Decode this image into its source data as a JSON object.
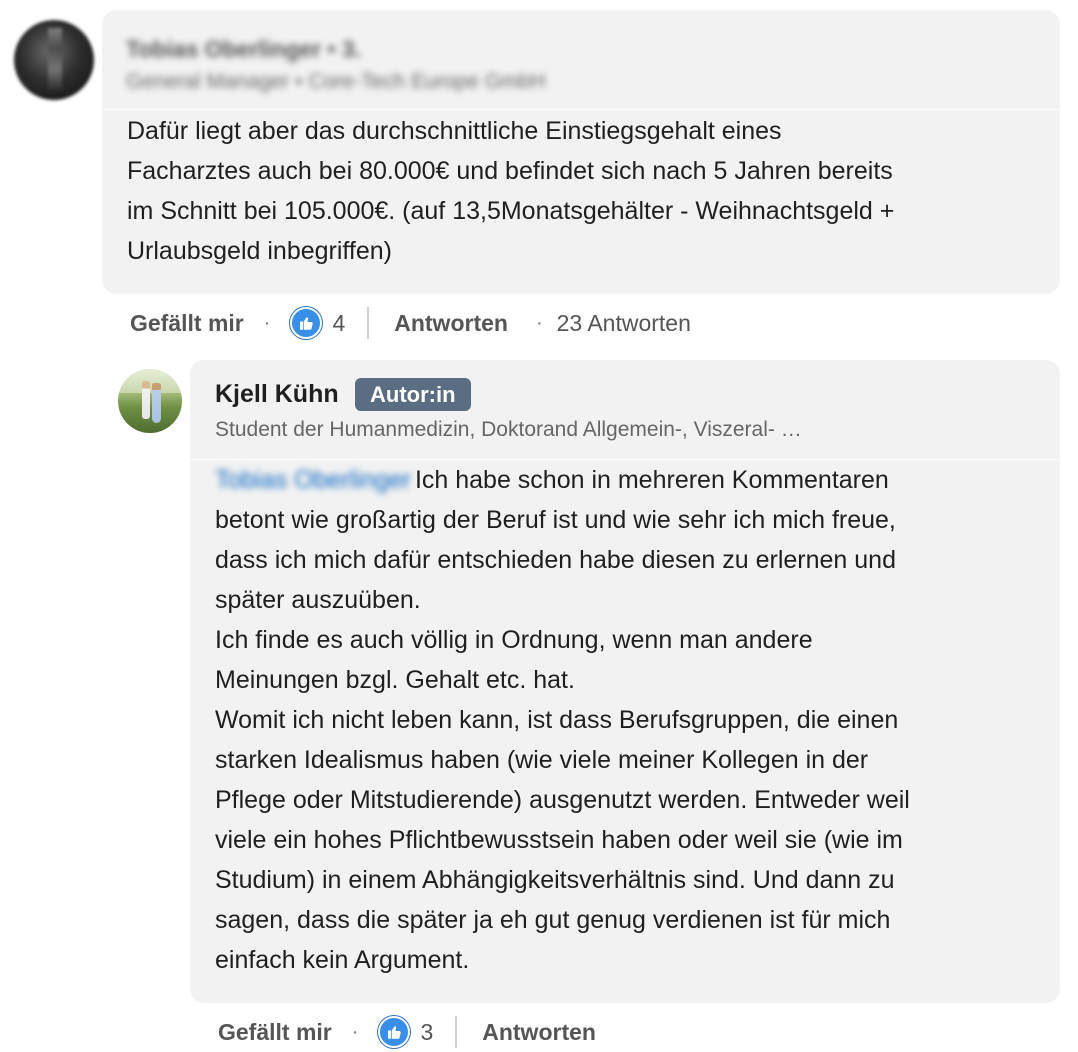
{
  "comment1": {
    "author_name": "Tobias Oberlinger • 3.",
    "author_headline": "General Manager • Core-Tech Europe GmbH",
    "text": "Dafür liegt aber das durchschnittliche Einstiegsgehalt eines\nFacharztes auch bei 80.000€ und befindet sich nach 5 Jahren bereits\nim Schnitt bei 105.000€. (auf 13,5Monatsgehälter - Weihnachtsgeld +\nUrlaubsgeld inbegriffen)",
    "like_label": "Gefällt mir",
    "like_count": "4",
    "reply_label": "Antworten",
    "replies_count_label": "23 Antworten"
  },
  "comment2": {
    "author_name": "Kjell Kühn",
    "author_badge": "Autor:in",
    "author_headline": "Student der Humanmedizin, Doktorand Allgemein-, Viszeral- …",
    "mention": "Tobias Oberlinger",
    "text_first_line": "Ich habe schon in mehreren Kommentaren",
    "text_rest": "betont wie großartig der Beruf ist und wie sehr ich mich freue,\ndass ich mich dafür entschieden habe diesen zu erlernen und\nspäter auszuüben.\nIch finde es auch völlig in Ordnung, wenn man andere\nMeinungen bzgl. Gehalt etc. hat.\nWomit ich nicht leben kann, ist dass Berufsgruppen, die einen\nstarken Idealismus haben (wie viele meiner Kollegen in der\nPflege oder Mitstudierende) ausgenutzt werden. Entweder weil\nviele ein hohes Pflichtbewusstsein haben oder weil sie (wie im\nStudium) in einem Abhängigkeitsverhältnis sind. Und dann zu\nsagen, dass die später ja eh gut genug verdienen ist für mich\neinfach kein Argument.",
    "like_label": "Gefällt mir",
    "like_count": "3",
    "reply_label": "Antworten"
  },
  "icons": {
    "like": "thumbs-up-icon"
  },
  "colors": {
    "bubble_bg": "#f2f2f2",
    "badge_bg": "#5b6d82",
    "like_blue": "#378fe9",
    "mention_blue": "#0a66c2"
  }
}
